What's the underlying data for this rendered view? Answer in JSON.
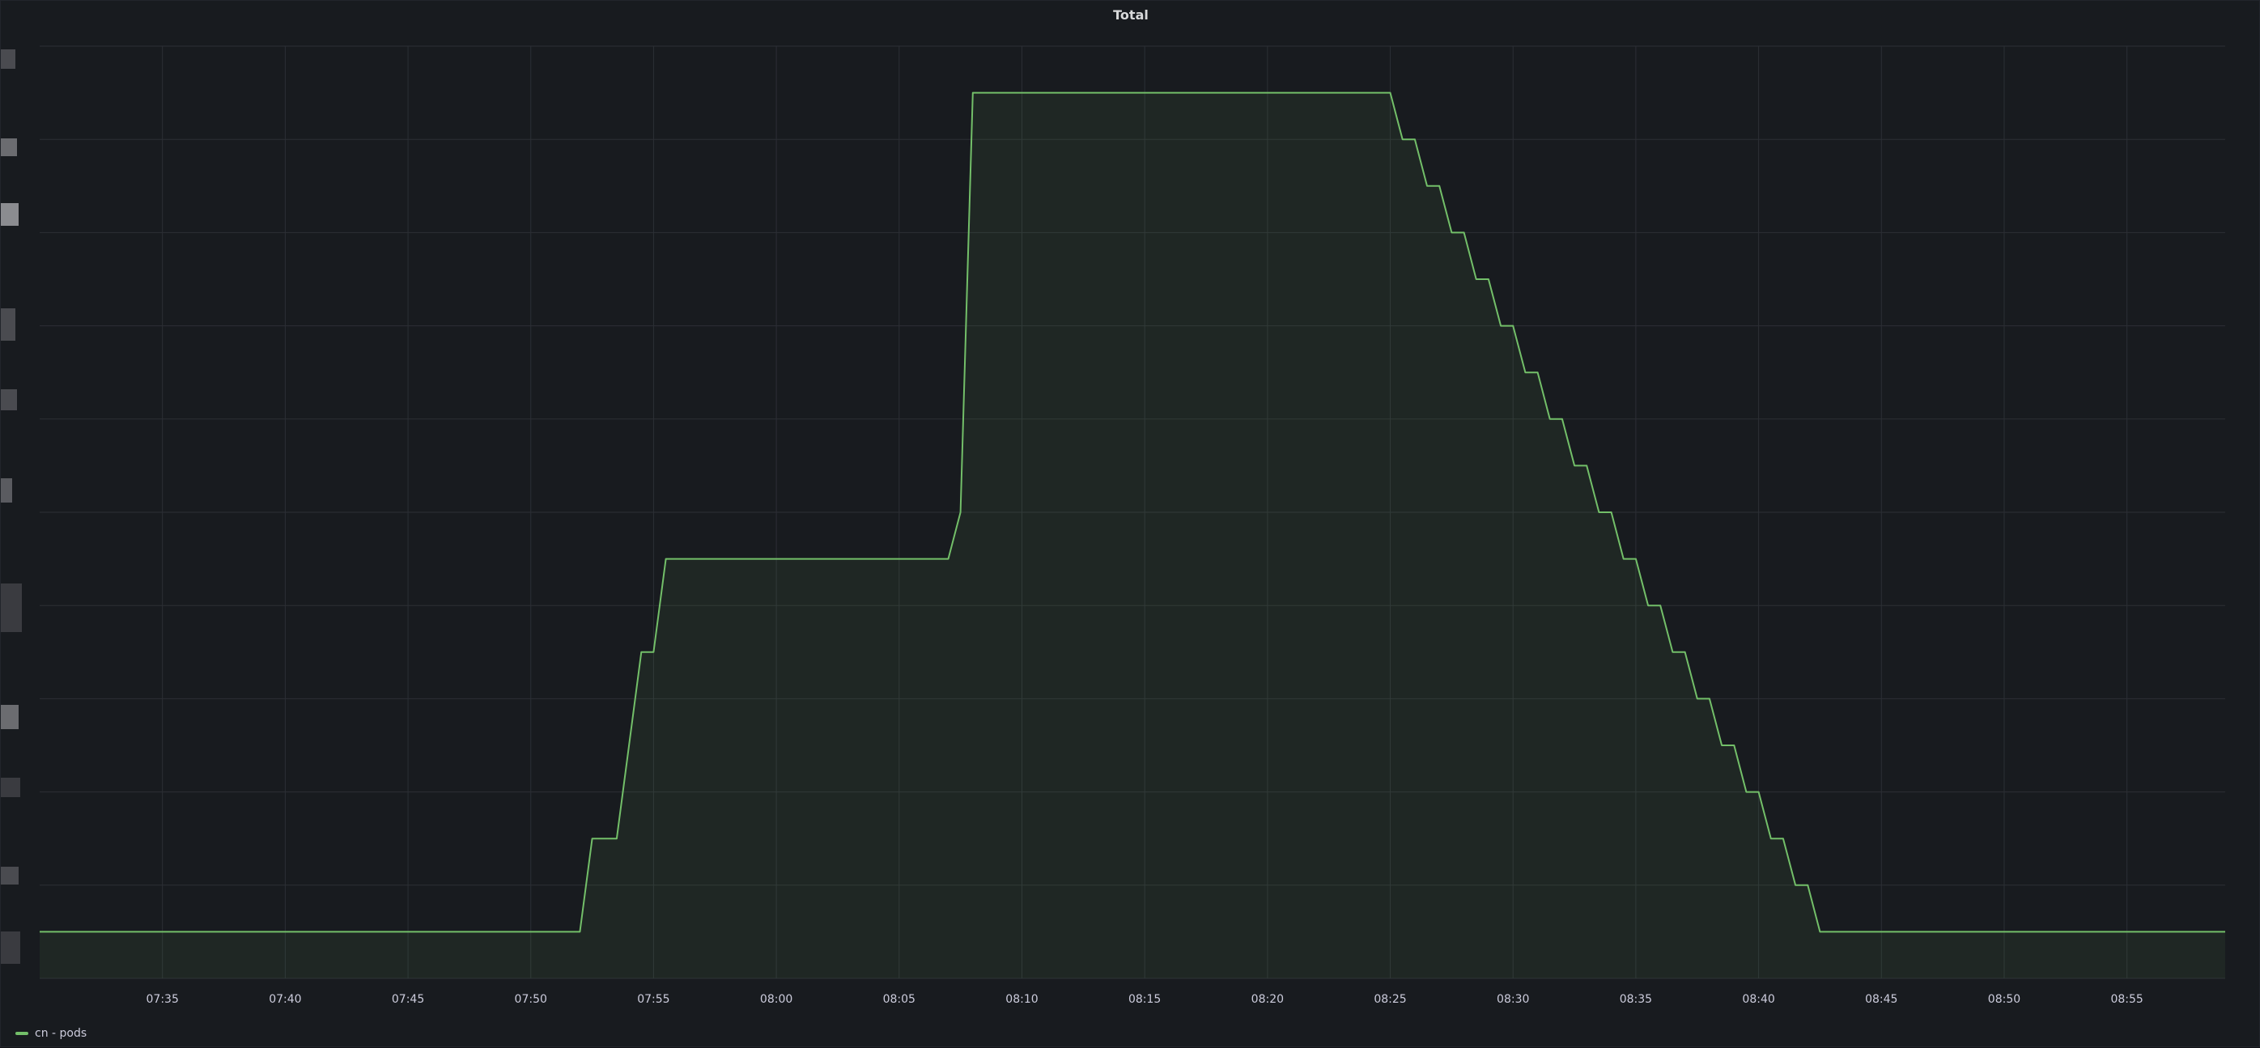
{
  "panel": {
    "title": "Total"
  },
  "chart_data": {
    "type": "area",
    "title": "Total",
    "xlabel": "",
    "ylabel": "",
    "x_ticks": [
      "07:35",
      "07:40",
      "07:45",
      "07:50",
      "07:55",
      "08:00",
      "08:05",
      "08:10",
      "08:15",
      "08:20",
      "08:25",
      "08:30",
      "08:35",
      "08:40",
      "08:45",
      "08:50",
      "08:55"
    ],
    "ylim": [
      0,
      20
    ],
    "grid": true,
    "legend_position": "bottom-left",
    "series": [
      {
        "name": "cn - pods",
        "color": "#73bf69",
        "x": [
          "07:30",
          "07:52",
          "07:52:30",
          "07:53:30",
          "07:54",
          "07:54:30",
          "07:55",
          "07:55:30",
          "07:56",
          "08:07",
          "08:07:30",
          "08:08",
          "08:25",
          "08:25:30",
          "08:26",
          "08:26:30",
          "08:27",
          "08:27:30",
          "08:28",
          "08:28:30",
          "08:29",
          "08:29:30",
          "08:30",
          "08:30:30",
          "08:31",
          "08:31:30",
          "08:32",
          "08:32:30",
          "08:33",
          "08:33:30",
          "08:34",
          "08:34:30",
          "08:35",
          "08:35:30",
          "08:36",
          "08:36:30",
          "08:37",
          "08:37:30",
          "08:38",
          "08:38:30",
          "08:39",
          "08:39:30",
          "08:40",
          "08:40:30",
          "08:41",
          "08:41:30",
          "08:42",
          "08:42:30",
          "08:43",
          "08:43:30",
          "08:44",
          "08:44:30",
          "08:45",
          "08:45:30",
          "08:59"
        ],
        "y": [
          1,
          1,
          3,
          3,
          5,
          7,
          7,
          9,
          9,
          9,
          10,
          19,
          19,
          18,
          18,
          17,
          17,
          16,
          16,
          15,
          15,
          14,
          14,
          13,
          13,
          12,
          12,
          11,
          11,
          10,
          10,
          9,
          9,
          8,
          8,
          7,
          7,
          6,
          6,
          5,
          5,
          4,
          4,
          3,
          3,
          2,
          2,
          1,
          1,
          1,
          1,
          1,
          1,
          1,
          1
        ]
      }
    ]
  }
}
